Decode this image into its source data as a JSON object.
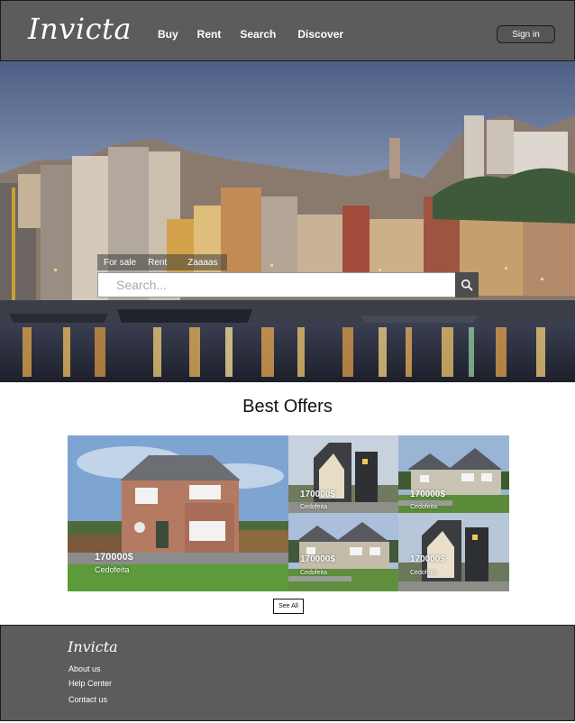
{
  "header": {
    "logo": "Invicta",
    "nav": [
      "Buy",
      "Rent",
      "Search",
      "Discover"
    ],
    "signin_label": "Sign in"
  },
  "hero": {
    "tabs": [
      "For sale",
      "Rent",
      "Zaaaas"
    ],
    "search_placeholder": "Search..."
  },
  "offers": {
    "title": "Best Offers",
    "cards": [
      {
        "price": "170000$",
        "location": "Cedofeita"
      },
      {
        "price": "170000$",
        "location": "Cedofeita"
      },
      {
        "price": "170000$",
        "location": "Cedofeita"
      },
      {
        "price": "170000$",
        "location": "Cedofeita"
      },
      {
        "price": "170000$",
        "location": "Cedofeita"
      }
    ],
    "see_all_label": "See All"
  },
  "footer": {
    "logo": "Invicta",
    "links": [
      "About us",
      "Help Center",
      "Contact us"
    ]
  }
}
